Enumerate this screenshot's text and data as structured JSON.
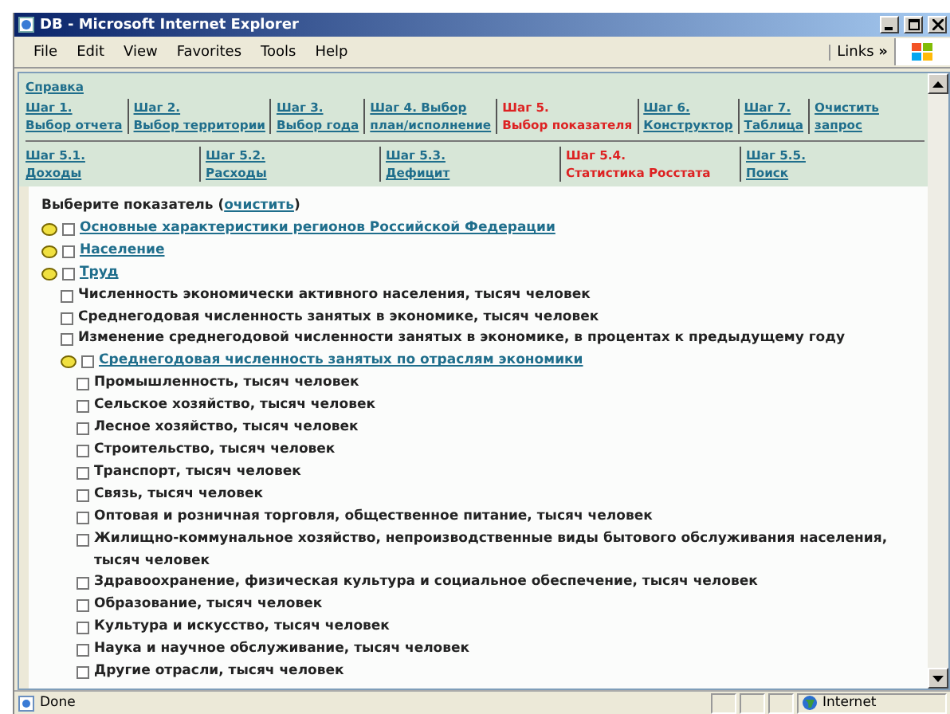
{
  "window": {
    "title": "DB - Microsoft Internet Explorer"
  },
  "menu": [
    "File",
    "Edit",
    "View",
    "Favorites",
    "Tools",
    "Help"
  ],
  "links_label": "Links",
  "links_chevron": "»",
  "help_link": "Справка",
  "steps": [
    {
      "lines": [
        "Шаг 1.",
        "Выбор отчета"
      ],
      "selected": false
    },
    {
      "lines": [
        "Шаг 2.",
        "Выбор территории"
      ],
      "selected": false
    },
    {
      "lines": [
        "Шаг 3.",
        "Выбор года"
      ],
      "selected": false
    },
    {
      "lines": [
        "Шаг 4. Выбор",
        "план/исполнение"
      ],
      "selected": false
    },
    {
      "lines": [
        "Шаг 5.",
        "Выбор показателя"
      ],
      "selected": true
    },
    {
      "lines": [
        "Шаг 6.",
        "Конструктор"
      ],
      "selected": false
    },
    {
      "lines": [
        "Шаг 7.",
        "Таблица"
      ],
      "selected": false
    },
    {
      "lines": [
        "Очистить",
        "запрос"
      ],
      "selected": false
    }
  ],
  "substeps": [
    {
      "lines": [
        "Шаг 5.1.",
        "Доходы"
      ],
      "selected": false
    },
    {
      "lines": [
        "Шаг 5.2.",
        "Расходы"
      ],
      "selected": false
    },
    {
      "lines": [
        "Шаг 5.3.",
        "Дефицит"
      ],
      "selected": false
    },
    {
      "lines": [
        "Шаг 5.4.",
        "Статистика Росстата"
      ],
      "selected": true
    },
    {
      "lines": [
        "Шаг 5.5.",
        "Поиск"
      ],
      "selected": false
    }
  ],
  "prompt": "Выберите показатель (",
  "clear_link": "очистить",
  "prompt_end": ")",
  "tree": [
    {
      "kind": "folder",
      "label": "Основные характеристики регионов Российской Федерации",
      "checked": false
    },
    {
      "kind": "folder",
      "label": "Население",
      "checked": false
    },
    {
      "kind": "folder",
      "label": "Труд",
      "checked": false,
      "children": [
        {
          "kind": "leaf",
          "label": "Численность экономически активного населения, тысяч человек",
          "checked": false
        },
        {
          "kind": "leaf",
          "label": "Среднегодовая численность занятых в экономике, тысяч человек",
          "checked": false
        },
        {
          "kind": "leaf",
          "label": "Изменение среднегодовой численности занятых в экономике, в процентах к предыдущему году",
          "checked": false
        },
        {
          "kind": "folder",
          "label": "Среднегодовая численность занятых по отраслям экономики",
          "checked": false,
          "children": [
            {
              "kind": "leaf",
              "label": "Промышленность, тысяч человек",
              "checked": false
            },
            {
              "kind": "leaf",
              "label": "Сельское хозяйство, тысяч человек",
              "checked": false
            },
            {
              "kind": "leaf",
              "label": "Лесное хозяйство, тысяч человек",
              "checked": false
            },
            {
              "kind": "leaf",
              "label": "Строительство, тысяч человек",
              "checked": false
            },
            {
              "kind": "leaf",
              "label": "Транспорт, тысяч человек",
              "checked": false
            },
            {
              "kind": "leaf",
              "label": "Связь, тысяч человек",
              "checked": false
            },
            {
              "kind": "leaf",
              "label": "Оптовая и розничная торговля, общественное питание, тысяч человек",
              "checked": false
            },
            {
              "kind": "leaf",
              "label": "Жилищно-коммунальное хозяйство, непроизводственные виды бытового обслуживания населения, тысяч человек",
              "checked": false
            },
            {
              "kind": "leaf",
              "label": "Здравоохранение, физическая культура и социальное обеспечение, тысяч человек",
              "checked": false
            },
            {
              "kind": "leaf",
              "label": "Образование, тысяч человек",
              "checked": false
            },
            {
              "kind": "leaf",
              "label": "Культура и искусство, тысяч человек",
              "checked": false
            },
            {
              "kind": "leaf",
              "label": "Наука и научное обслуживание, тысяч человек",
              "checked": false
            },
            {
              "kind": "leaf",
              "label": "Другие отрасли, тысяч человек",
              "checked": false
            }
          ]
        }
      ]
    }
  ],
  "status_bar": {
    "text": "Done",
    "zone": "Internet"
  }
}
